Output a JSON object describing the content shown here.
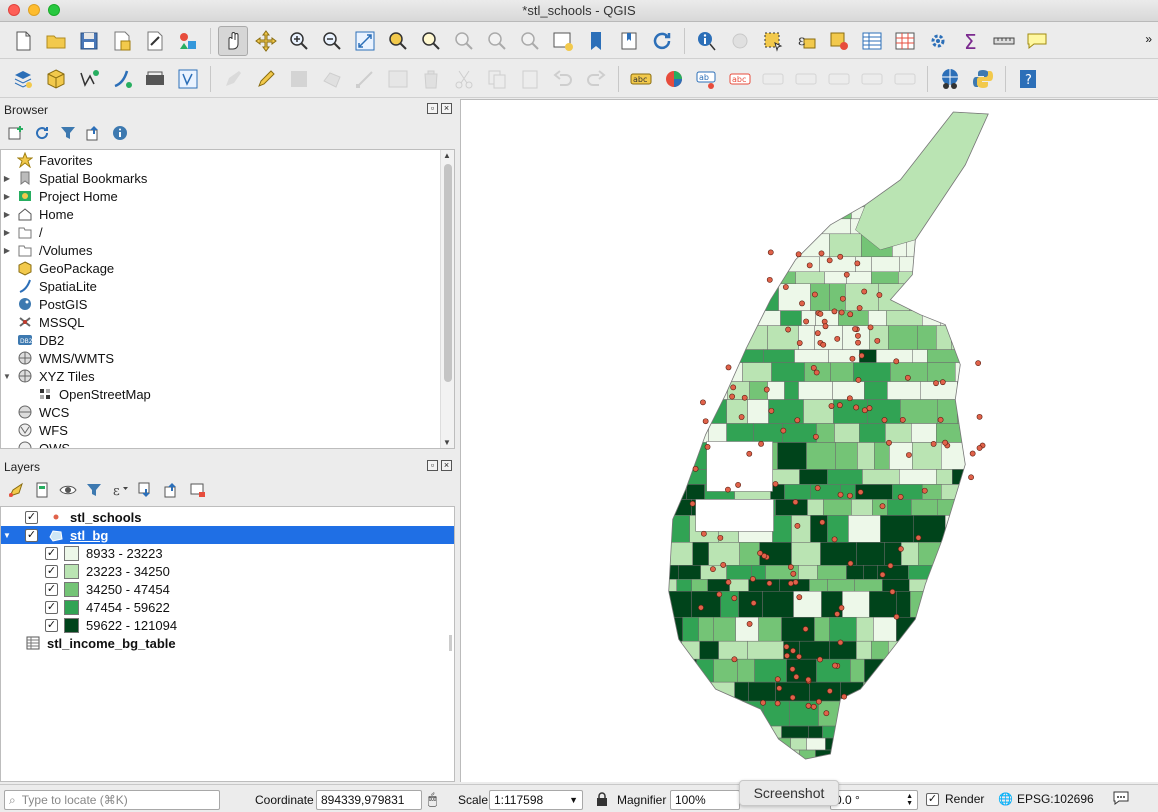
{
  "window": {
    "title": "*stl_schools - QGIS"
  },
  "browser_panel": {
    "title": "Browser",
    "items": [
      {
        "label": "Favorites",
        "icon": "star-icon",
        "expandable": false
      },
      {
        "label": "Spatial Bookmarks",
        "icon": "bookmark-icon",
        "expandable": true
      },
      {
        "label": "Project Home",
        "icon": "project-home-icon",
        "expandable": true
      },
      {
        "label": "Home",
        "icon": "home-icon",
        "expandable": true
      },
      {
        "label": "/",
        "icon": "folder-icon",
        "expandable": true
      },
      {
        "label": "/Volumes",
        "icon": "folder-icon",
        "expandable": true
      },
      {
        "label": "GeoPackage",
        "icon": "geopackage-icon",
        "expandable": false
      },
      {
        "label": "SpatiaLite",
        "icon": "spatialite-icon",
        "expandable": false
      },
      {
        "label": "PostGIS",
        "icon": "postgis-icon",
        "expandable": false
      },
      {
        "label": "MSSQL",
        "icon": "mssql-icon",
        "expandable": false
      },
      {
        "label": "DB2",
        "icon": "db2-icon",
        "expandable": false
      },
      {
        "label": "WMS/WMTS",
        "icon": "wms-icon",
        "expandable": false
      },
      {
        "label": "XYZ Tiles",
        "icon": "xyz-tiles-icon",
        "expandable": true,
        "expanded": true
      },
      {
        "label": "OpenStreetMap",
        "icon": "osm-icon",
        "expandable": false,
        "indent": 1
      },
      {
        "label": "WCS",
        "icon": "wcs-icon",
        "expandable": false
      },
      {
        "label": "WFS",
        "icon": "wfs-icon",
        "expandable": false
      },
      {
        "label": "OWS",
        "icon": "ows-icon",
        "expandable": false
      }
    ]
  },
  "layers_panel": {
    "title": "Layers",
    "layers": [
      {
        "name": "stl_schools",
        "checked": true,
        "type": "point"
      },
      {
        "name": "stl_bg",
        "checked": true,
        "type": "polygon",
        "selected": true
      },
      {
        "name": "stl_income_bg_table",
        "checked": false,
        "type": "table"
      }
    ],
    "legend": [
      {
        "label": "8933 - 23223",
        "color": "#edf8e9",
        "checked": true
      },
      {
        "label": "23223 - 34250",
        "color": "#bae4b3",
        "checked": true
      },
      {
        "label": "34250 - 47454",
        "color": "#74c476",
        "checked": true
      },
      {
        "label": "47454 - 59622",
        "color": "#31a354",
        "checked": true
      },
      {
        "label": "59622 - 121094",
        "color": "#00441b",
        "checked": true
      }
    ]
  },
  "statusbar": {
    "locate_placeholder": "Type to locate (⌘K)",
    "coordinate_label": "Coordinate",
    "coordinate_value": "894339,979831",
    "scale_label": "Scale",
    "scale_value": "1:117598",
    "magnifier_label": "Magnifier",
    "magnifier_value": "100%",
    "rotation_value": "0.0 °",
    "render_label": "Render",
    "crs_label": "EPSG:102696"
  },
  "tooltip": {
    "text": "Screenshot"
  },
  "colors": {
    "selection": "#1f6fe5",
    "school_point": "#e0624a"
  }
}
